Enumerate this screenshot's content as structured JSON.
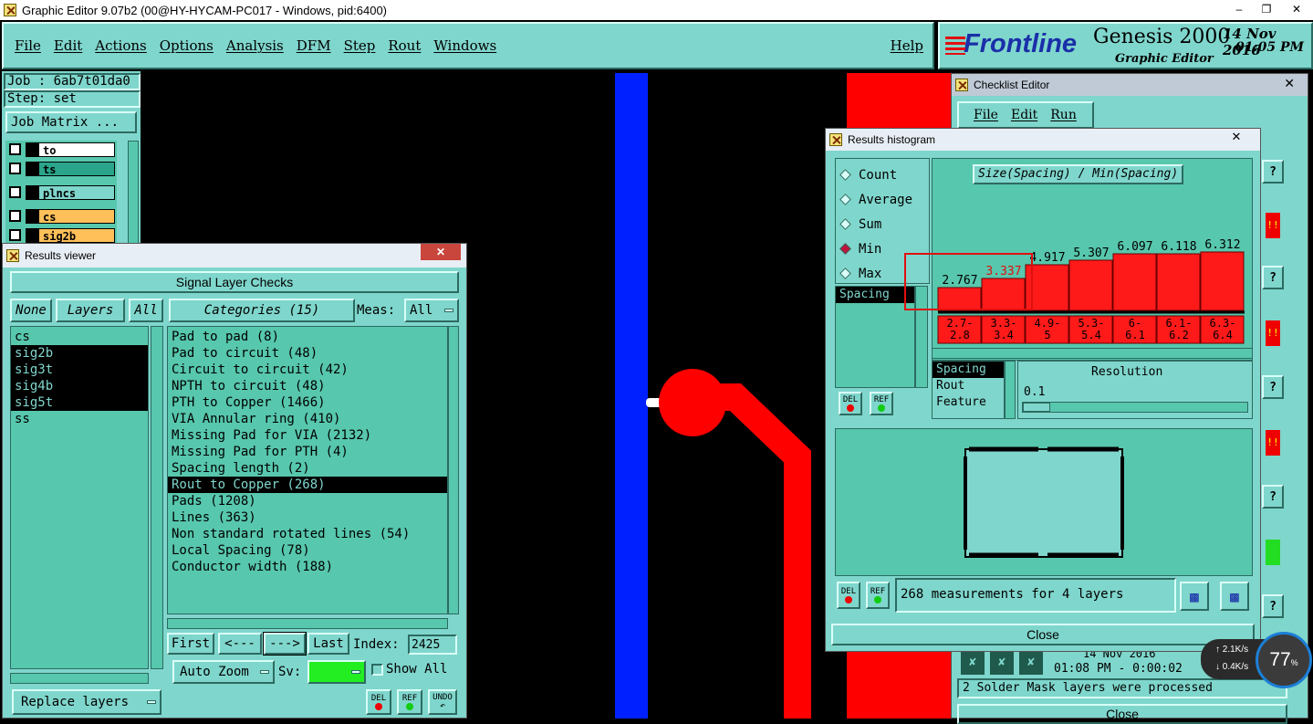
{
  "window": {
    "title": "Graphic Editor 9.07b2 (00@HY-HYCAM-PC017 - Windows, pid:6400)"
  },
  "menu": [
    "File",
    "Edit",
    "Actions",
    "Options",
    "Analysis",
    "DFM",
    "Step",
    "Rout",
    "Windows"
  ],
  "help_label": "Help",
  "brand": {
    "logo": "Frontline",
    "product": "Genesis 2000",
    "subtitle": "Graphic Editor",
    "date": "14 Nov 2016",
    "time": "01:05 PM"
  },
  "job": {
    "job_line": "Job : 6ab7t01da0",
    "step_line": "Step: set",
    "matrix_btn": "Job Matrix ..."
  },
  "layers": [
    {
      "name": "to",
      "color": "#ffffff"
    },
    {
      "name": "ts",
      "color": "#2aa58b"
    },
    {
      "name": "plncs",
      "color": "#7fd6cc"
    },
    {
      "name": "cs",
      "color": "#ffc05a"
    },
    {
      "name": "sig2b",
      "color": "#ffc05a"
    },
    {
      "name": "sig3t",
      "color": "#ffc05a"
    }
  ],
  "results_viewer": {
    "title": "Results viewer",
    "header": "Signal Layer Checks",
    "none_btn": "None",
    "layers_btn": "Layers",
    "all_btn": "All",
    "categories_btn": "Categories (15)",
    "meas_label": "Meas:",
    "meas_value": "All",
    "layer_list": [
      "cs",
      "sig2b",
      "sig3t",
      "sig4b",
      "sig5t",
      "ss"
    ],
    "categories": [
      "Pad to pad (8)",
      "Pad to circuit (48)",
      "Circuit to circuit (42)",
      "NPTH to circuit (48)",
      "PTH to Copper (1466)",
      "VIA Annular ring (410)",
      "Missing Pad for VIA (2132)",
      "Missing Pad for PTH (4)",
      "Spacing length (2)",
      "Rout to Copper (268)",
      "Pads (1208)",
      "Lines (363)",
      "Non standard rotated lines (54)",
      "Local Spacing (78)",
      "Conductor width (188)"
    ],
    "first": "First",
    "prev": "<---",
    "next": "--->",
    "last": "Last",
    "index_label": "Index:",
    "index_value": "2425",
    "autozoom": "Auto Zoom",
    "sv_label": "Sv:",
    "show_all": "Show All",
    "replace": "Replace layers",
    "del": "DEL",
    "ref": "REF",
    "undo": "UNDO"
  },
  "histogram": {
    "title": "Results histogram",
    "radios": [
      "Count",
      "Average",
      "Sum",
      "Min",
      "Max"
    ],
    "selected": "Min",
    "chart_title": "Size(Spacing) / Min(Spacing)",
    "list": [
      "Spacing"
    ],
    "values": [
      "2.767",
      "3.337",
      "4.917",
      "5.307",
      "6.097",
      "6.118",
      "6.312"
    ],
    "heights": [
      0.25,
      0.35,
      0.5,
      0.55,
      0.62,
      0.62,
      0.64
    ],
    "bins": [
      "2.7-\n2.8",
      "3.3-\n3.4",
      "4.9-\n5",
      "5.3-\n5.4",
      "6-\n6.1",
      "6.1-\n6.2",
      "6.3-\n6.4"
    ],
    "fields": [
      "Spacing",
      "Rout",
      "Feature"
    ],
    "resolution_label": "Resolution",
    "resolution_value": "0.1",
    "status": "268 measurements for 4 layers",
    "close": "Close"
  },
  "checklist": {
    "title": "Checklist Editor",
    "menu": [
      "File",
      "Edit",
      "Run"
    ],
    "date": "14 Nov 2016",
    "time": "01:08 PM - 0:00:02",
    "message": "2 Solder Mask layers were processed",
    "close": "Close"
  },
  "net": {
    "up": "2.1K/s",
    "down": "0.4K/s",
    "percent": "77"
  }
}
